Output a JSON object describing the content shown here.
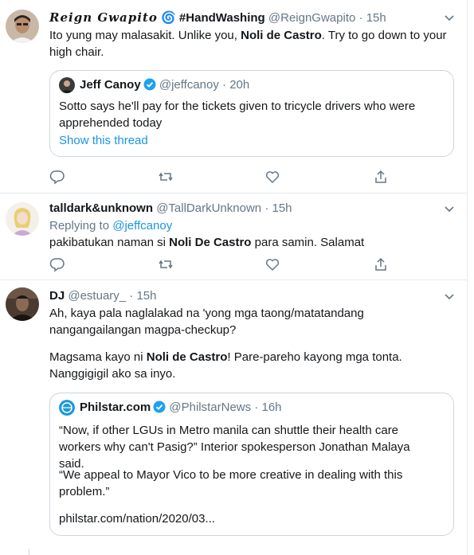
{
  "tweets": [
    {
      "author_name": "Reign Gwapito",
      "author_emoji": "🌀",
      "hashtag": "#HandWashing",
      "handle": "@ReignGwapito",
      "sep": "·",
      "time": "15h",
      "text_pre": "Ito yung may malasakit. Unlike you, ",
      "text_bold": "Noli de Castro",
      "text_post": ". Try to go down to your high chair.",
      "quote": {
        "name": "Jeff Canoy",
        "handle": "@jeffcanoy",
        "sep": "·",
        "time": "20h",
        "text": "Sotto says he'll pay for the tickets given to tricycle drivers who were apprehended today",
        "show_thread": "Show this thread"
      }
    },
    {
      "author_name": "talldark&unknown",
      "handle": "@TallDarkUnknown",
      "sep": "·",
      "time": "15h",
      "replying_label": "Replying to ",
      "replying_handle": "@jeffcanoy",
      "text_pre": "pakibatukan naman si ",
      "text_bold": "Noli De Castro",
      "text_post": " para samin. Salamat"
    },
    {
      "author_name": "DJ",
      "handle": "@estuary_",
      "sep": "·",
      "time": "15h",
      "text_line1": "Ah, kaya pala naglalakad na 'yong mga taong/matatandang nangangailangan magpa-checkup?",
      "text_pre": "Magsama kayo ni ",
      "text_bold": "Noli de Castro",
      "text_post": "! Pare-pareho kayong mga tonta. Nanggigigil ako sa inyo.",
      "quote": {
        "name": "Philstar.com",
        "handle": "@PhilstarNews",
        "sep": "·",
        "time": "16h",
        "text1": "“Now, if other LGUs in Metro manila can shuttle their health care workers why can't Pasig?” Interior spokesperson Jonathan Malaya said.",
        "text2": "“We appeal to Mayor Vico to be more creative in dealing with this problem.”",
        "link": "philstar.com/nation/2020/03..."
      }
    }
  ],
  "icons": {
    "reply": "reply-icon",
    "retweet": "retweet-icon",
    "like": "heart-icon",
    "share": "share-icon",
    "caret": "chevron-down-icon",
    "verified": "verified-badge-icon"
  },
  "colors": {
    "accent": "#1b95e0",
    "muted": "#657786",
    "border": "#e6ecf0"
  }
}
